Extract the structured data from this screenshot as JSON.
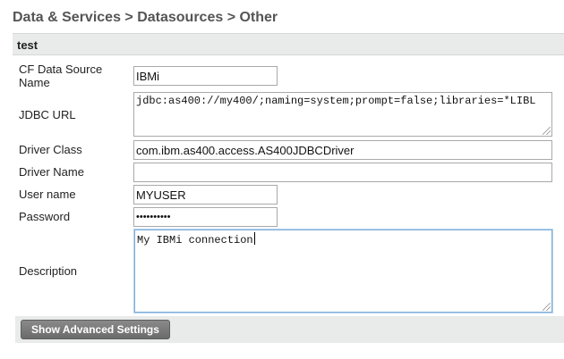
{
  "breadcrumb": "Data & Services > Datasources > Other",
  "section": {
    "title": "test"
  },
  "form": {
    "cf_name_label_line1": "CF Data Source",
    "cf_name_label_line2": "Name",
    "cf_name_value": "IBMi",
    "jdbc_url_label": "JDBC URL",
    "jdbc_url_value": "jdbc:as400://my400/;naming=system;prompt=false;libraries=*LIBL",
    "driver_class_label": "Driver Class",
    "driver_class_value": "com.ibm.as400.access.AS400JDBCDriver",
    "driver_name_label": "Driver Name",
    "driver_name_value": "",
    "username_label": "User name",
    "username_value": "MYUSER",
    "password_label": "Password",
    "password_value": "••••••••••",
    "description_label": "Description",
    "description_value": "My IBMi connection"
  },
  "footer": {
    "advanced_button": "Show Advanced Settings"
  }
}
